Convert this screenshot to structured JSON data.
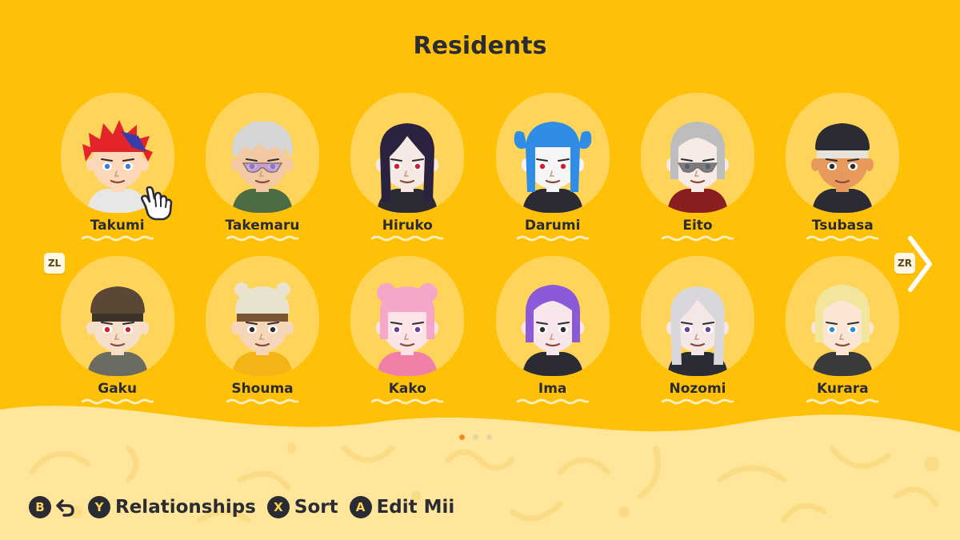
{
  "screen_title": "Residents",
  "residents": [
    {
      "name": "Takumi",
      "hair": "#e3252b",
      "hair2": "#3a3da8",
      "style": "spiky",
      "skin": "#fcd7b8",
      "shirt": "#e7e7e7",
      "eyes": "#3a7fd9"
    },
    {
      "name": "Takemaru",
      "hair": "#d6d6d6",
      "style": "messy",
      "skin": "#f2c9a3",
      "shirt": "#4d6b45",
      "glasses": "#b98de0",
      "eyes": "#2a2b33"
    },
    {
      "name": "Hiruko",
      "hair": "#2b2240",
      "style": "long",
      "skin": "#f6e9e4",
      "shirt": "#2a2b33",
      "eyes": "#d11f2b"
    },
    {
      "name": "Darumi",
      "hair": "#2f8de6",
      "style": "twin",
      "skin": "#f5f5f5",
      "shirt": "#2a2b33",
      "eyes": "#d11f2b"
    },
    {
      "name": "Eito",
      "hair": "#bdbdbd",
      "style": "bob",
      "skin": "#f7ebe6",
      "shirt": "#8a1e1e",
      "glasses": "#555555",
      "eyes": "#3a7fd9"
    },
    {
      "name": "Tsubasa",
      "hair": "#e7e2dc",
      "style": "cap",
      "hat": "#2a2b33",
      "skin": "#e8995c",
      "shirt": "#2a2b33",
      "eyes": "#2a2b33"
    },
    {
      "name": "Gaku",
      "hair": "#3d3128",
      "style": "cap",
      "hat": "#5a4736",
      "skin": "#f5dfc9",
      "shirt": "#6b6b62",
      "eyes": "#d11f2b"
    },
    {
      "name": "Shouma",
      "hair": "#7a5632",
      "style": "beanie",
      "hat": "#e9e2cf",
      "skin": "#f6d6b9",
      "shirt": "#f2b515",
      "eyes": "#2a2b33"
    },
    {
      "name": "Kako",
      "hair": "#f6a6c8",
      "style": "buns",
      "skin": "#fbe3e6",
      "shirt": "#f27fa7",
      "eyes": "#6a3f9a"
    },
    {
      "name": "Ima",
      "hair": "#8b5ad9",
      "style": "bob",
      "skin": "#f7e6ea",
      "shirt": "#2a2b33",
      "eyes": "#2a2b33"
    },
    {
      "name": "Nozomi",
      "hair": "#d9d7dc",
      "style": "long",
      "skin": "#f6e7e7",
      "shirt": "#2a2b33",
      "eyes": "#6a3f9a"
    },
    {
      "name": "Kurara",
      "hair": "#f1e69c",
      "style": "bob",
      "skin": "#fbe6d6",
      "shirt": "#3a3a3a",
      "eyes": "#2a8fd0"
    }
  ],
  "shoulder_left": "ZL",
  "shoulder_right": "ZR",
  "page_indicator": {
    "total": 3,
    "current": 1
  },
  "controls": [
    {
      "key": "B",
      "label": ""
    },
    {
      "key": "Y",
      "label": "Relationships"
    },
    {
      "key": "X",
      "label": "Sort"
    },
    {
      "key": "A",
      "label": "Edit Mii"
    }
  ],
  "colors": {
    "background": "#ffc107",
    "card": "#ffd45a",
    "bottom_area": "#ffe69a",
    "text": "#2a2b33",
    "dot_active": "#f08a1d"
  }
}
